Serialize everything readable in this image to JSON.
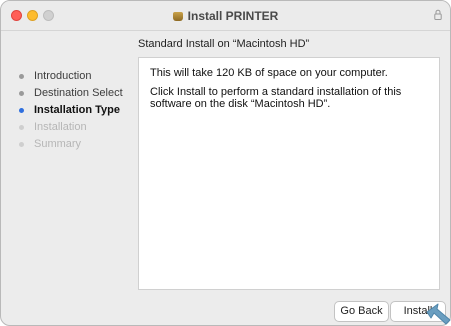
{
  "window": {
    "title": "Install PRINTER",
    "icons": {
      "close": "close-icon",
      "minimize": "minimize-icon",
      "zoom": "zoom-icon",
      "package": "package-icon",
      "lock": "lock-icon"
    }
  },
  "header": {
    "subtitle": "Standard Install on “Macintosh HD”"
  },
  "sidebar": {
    "steps": [
      {
        "label": "Introduction",
        "state": "done"
      },
      {
        "label": "Destination Select",
        "state": "done"
      },
      {
        "label": "Installation Type",
        "state": "current"
      },
      {
        "label": "Installation",
        "state": "future"
      },
      {
        "label": "Summary",
        "state": "future"
      }
    ]
  },
  "content": {
    "space_text": "This will take 120 KB of space on your computer.",
    "instructions": "Click Install to perform a standard installation of this software on the disk “Macintosh HD”."
  },
  "buttons": {
    "back_label": "Go Back",
    "install_label": "Install"
  },
  "colors": {
    "accent": "#2f6fde",
    "close": "#ff5f57",
    "minimize": "#febc2e",
    "pointer": "#6a9ec0"
  }
}
